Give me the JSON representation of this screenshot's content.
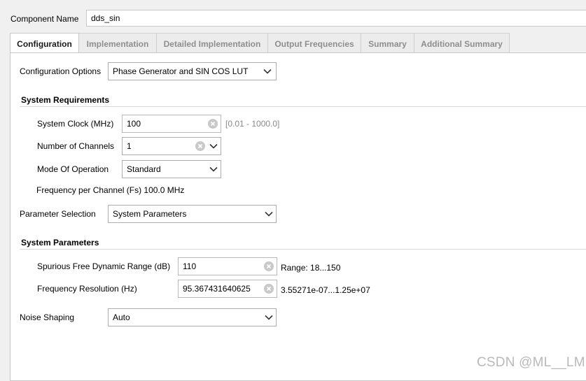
{
  "component_name": {
    "label": "Component Name",
    "value": "dds_sin"
  },
  "tabs": [
    {
      "label": "Configuration"
    },
    {
      "label": "Implementation"
    },
    {
      "label": "Detailed Implementation"
    },
    {
      "label": "Output Frequencies"
    },
    {
      "label": "Summary"
    },
    {
      "label": "Additional Summary"
    }
  ],
  "configuration_options": {
    "label": "Configuration Options",
    "value": "Phase Generator and SIN COS LUT"
  },
  "system_requirements": {
    "title": "System Requirements",
    "system_clock": {
      "label": "System Clock (MHz)",
      "value": "100",
      "range": "[0.01 - 1000.0]"
    },
    "channels": {
      "label": "Number of Channels",
      "value": "1"
    },
    "mode": {
      "label": "Mode Of Operation",
      "value": "Standard"
    },
    "fs_text": "Frequency per Channel (Fs) 100.0 MHz"
  },
  "parameter_selection": {
    "label": "Parameter Selection",
    "value": "System Parameters"
  },
  "system_parameters": {
    "title": "System Parameters",
    "sfdr": {
      "label": "Spurious Free Dynamic Range (dB)",
      "value": "110",
      "range": "Range: 18...150"
    },
    "freq_res": {
      "label": "Frequency Resolution (Hz)",
      "value": "95.367431640625",
      "range": "3.55271e-07...1.25e+07"
    }
  },
  "noise_shaping": {
    "label": "Noise Shaping",
    "value": "Auto"
  },
  "watermark": "CSDN @ML__LM",
  "icons": {
    "clear": "clear-icon",
    "dropdown": "chevron-down-icon"
  }
}
